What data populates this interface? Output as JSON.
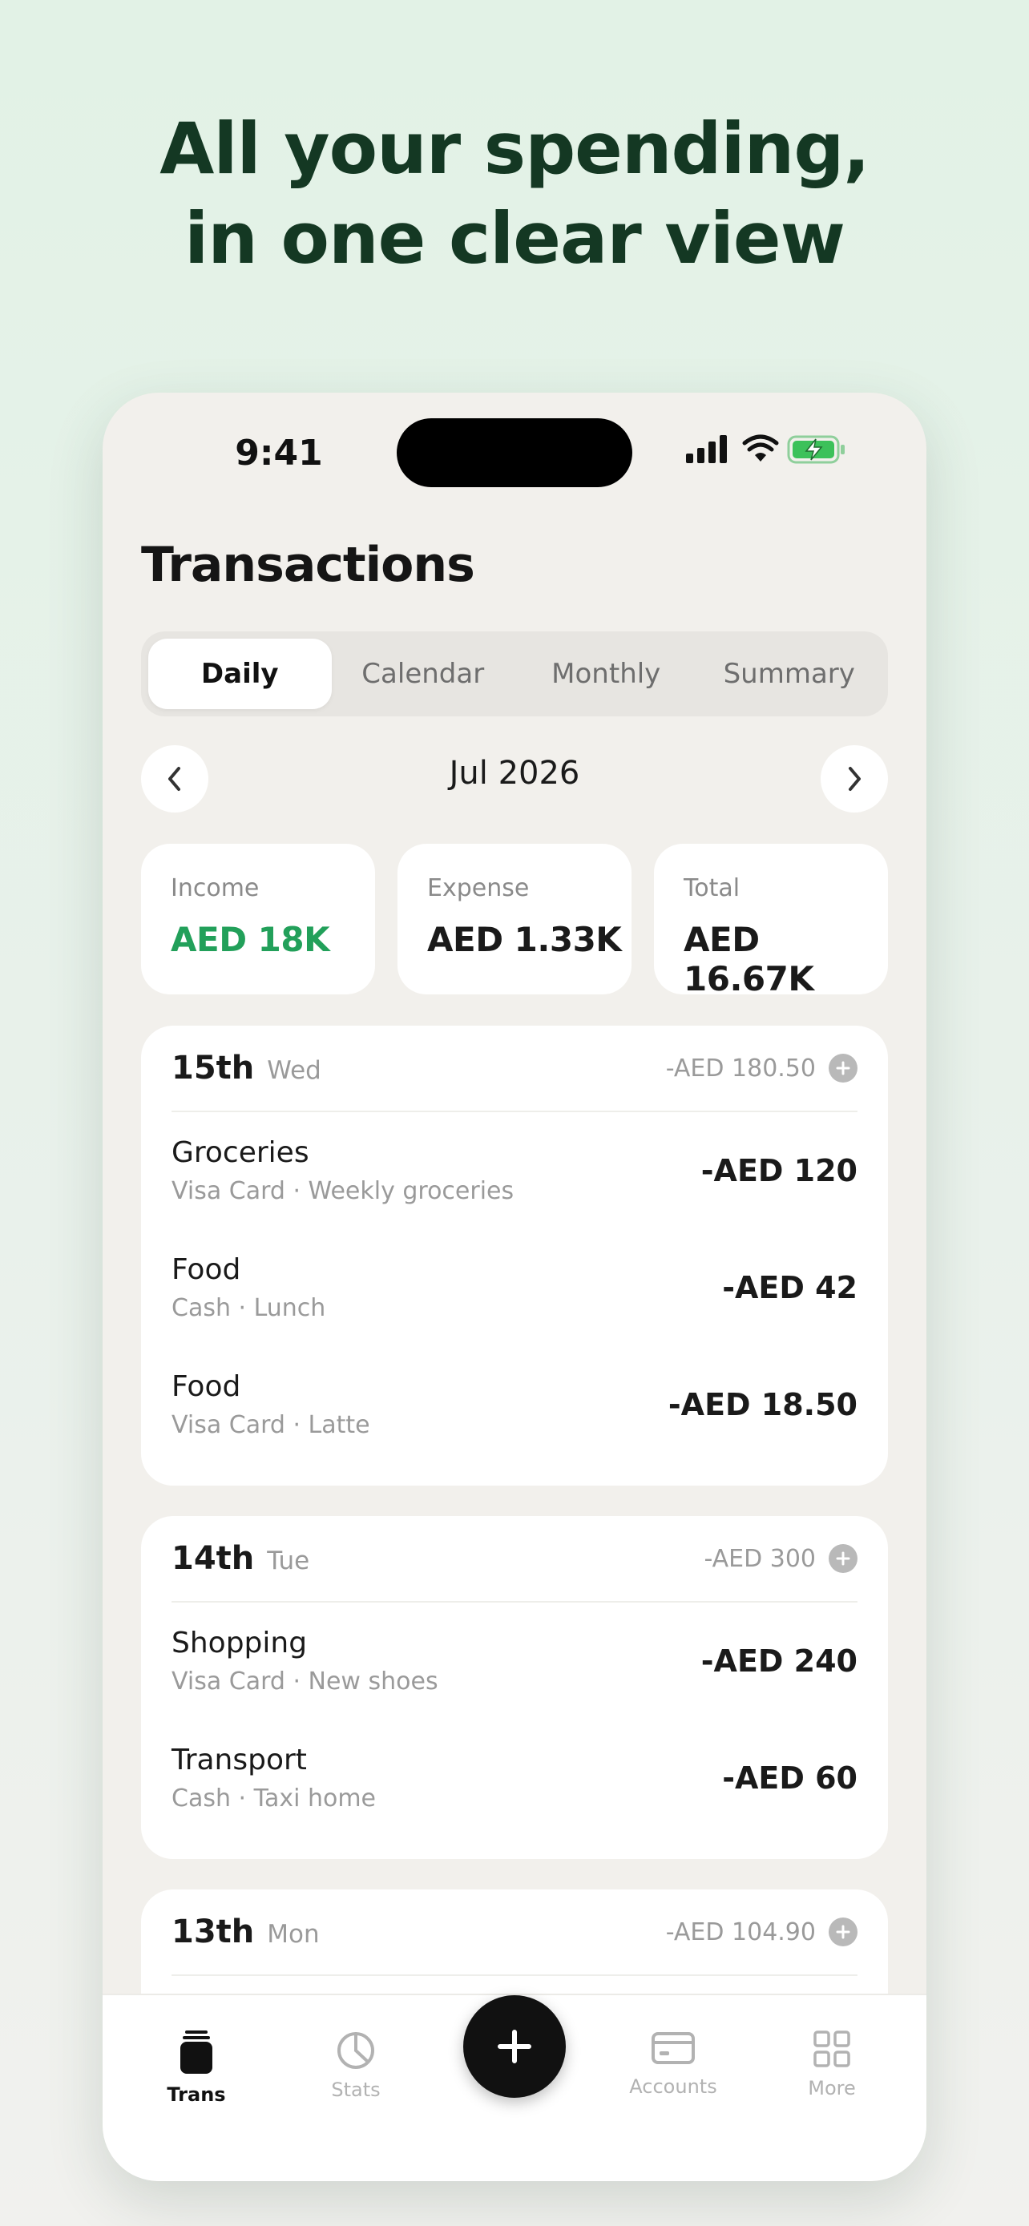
{
  "headline": {
    "line1": "All your spending,",
    "line2": "in one clear view"
  },
  "status_bar": {
    "time": "9:41",
    "icons": [
      "cellular-signal-icon",
      "wifi-icon",
      "battery-charging-icon"
    ]
  },
  "screen": {
    "title": "Transactions",
    "tabs": [
      {
        "label": "Daily",
        "active": true
      },
      {
        "label": "Calendar",
        "active": false
      },
      {
        "label": "Monthly",
        "active": false
      },
      {
        "label": "Summary",
        "active": false
      }
    ],
    "month": "Jul 2026",
    "summary": {
      "income": {
        "label": "Income",
        "value": "AED 18K"
      },
      "expense": {
        "label": "Expense",
        "value": "AED 1.33K"
      },
      "total": {
        "label": "Total",
        "value": "AED 16.67K"
      }
    },
    "days": [
      {
        "day": "15th",
        "weekday": "Wed",
        "total": "-AED 180.50",
        "transactions": [
          {
            "category": "Groceries",
            "detail": "Visa Card · Weekly groceries",
            "amount": "-AED 120"
          },
          {
            "category": "Food",
            "detail": "Cash · Lunch",
            "amount": "-AED 42"
          },
          {
            "category": "Food",
            "detail": "Visa Card · Latte",
            "amount": "-AED 18.50"
          }
        ]
      },
      {
        "day": "14th",
        "weekday": "Tue",
        "total": "-AED 300",
        "transactions": [
          {
            "category": "Shopping",
            "detail": "Visa Card · New shoes",
            "amount": "-AED 240"
          },
          {
            "category": "Transport",
            "detail": "Cash · Taxi home",
            "amount": "-AED 60"
          }
        ]
      },
      {
        "day": "13th",
        "weekday": "Mon",
        "total": "-AED 104.90",
        "transactions": []
      }
    ]
  },
  "bottom_nav": {
    "items": [
      {
        "label": "Trans",
        "icon": "wallet-icon",
        "active": true
      },
      {
        "label": "Stats",
        "icon": "pie-chart-icon",
        "active": false
      },
      {
        "label": "Accounts",
        "icon": "card-icon",
        "active": false
      },
      {
        "label": "More",
        "icon": "grid-icon",
        "active": false
      }
    ],
    "fab_icon": "plus-icon"
  },
  "colors": {
    "income": "#22a05a",
    "headline": "#143823",
    "fab": "#111111"
  }
}
